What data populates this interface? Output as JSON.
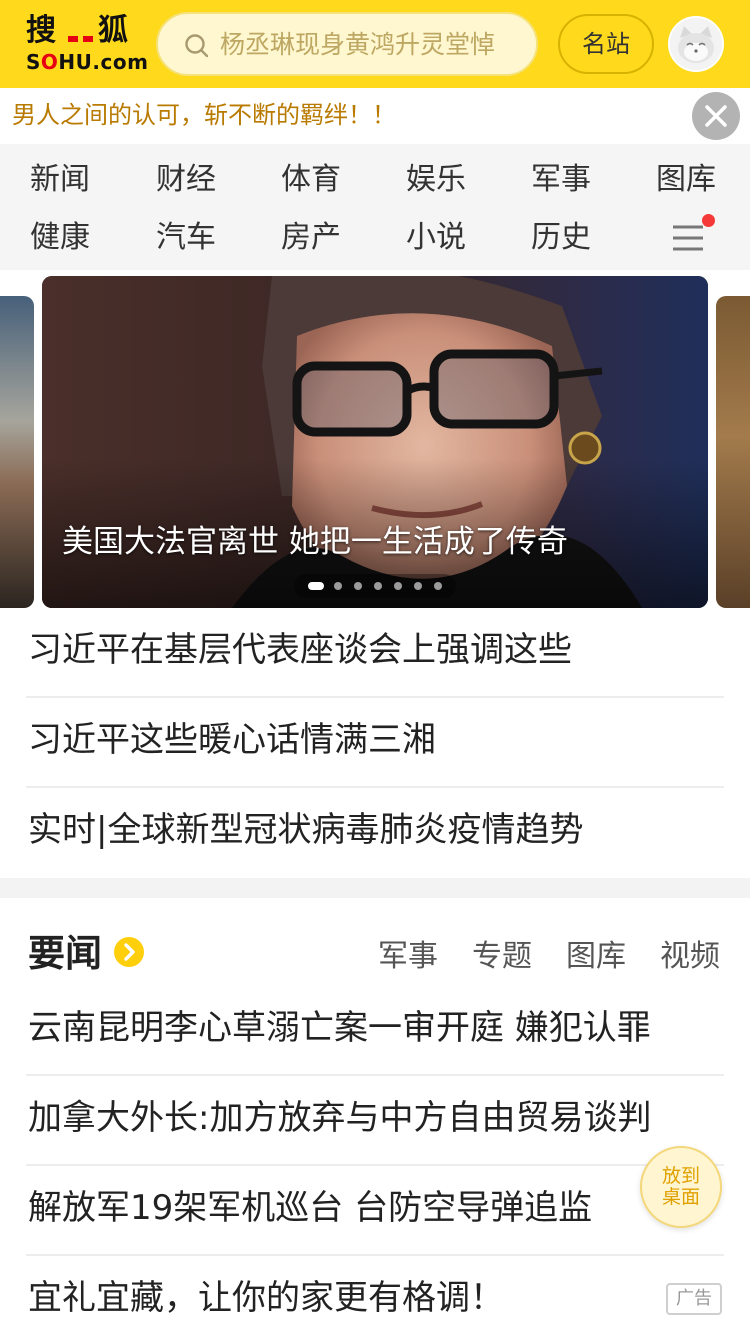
{
  "header": {
    "logo_cn_1": "搜",
    "logo_cn_2": "狐",
    "logo_en_pre": "S",
    "logo_en_red": "O",
    "logo_en_post": "HU.com",
    "search_placeholder": "杨丞琳现身黄鸿升灵堂悼",
    "mingzhan_label": "名站",
    "accent_color": "#ffd91c"
  },
  "ticker": {
    "text": "男人之间的认可，斩不断的羁绊！！"
  },
  "nav": {
    "items": [
      "新闻",
      "财经",
      "体育",
      "娱乐",
      "军事",
      "图库",
      "健康",
      "汽车",
      "房产",
      "小说",
      "历史"
    ]
  },
  "carousel": {
    "caption": "美国大法官离世 她把一生活成了传奇",
    "total_slides": 7,
    "active_slide": 1
  },
  "top_headlines": [
    "习近平在基层代表座谈会上强调这些",
    "习近平这些暖心话情满三湘",
    "实时|全球新型冠状病毒肺炎疫情趋势"
  ],
  "section": {
    "title": "要闻",
    "tabs": [
      "军事",
      "专题",
      "图库",
      "视频"
    ]
  },
  "news": [
    "云南昆明李心草溺亡案一审开庭 嫌犯认罪",
    "加拿大外长:加方放弃与中方自由贸易谈判",
    "解放军19架军机巡台 台防空导弹追监",
    "宜礼宜藏，让你的家更有格调！"
  ],
  "ad_label": "广告",
  "float_button": {
    "line1": "放到",
    "line2": "桌面"
  }
}
